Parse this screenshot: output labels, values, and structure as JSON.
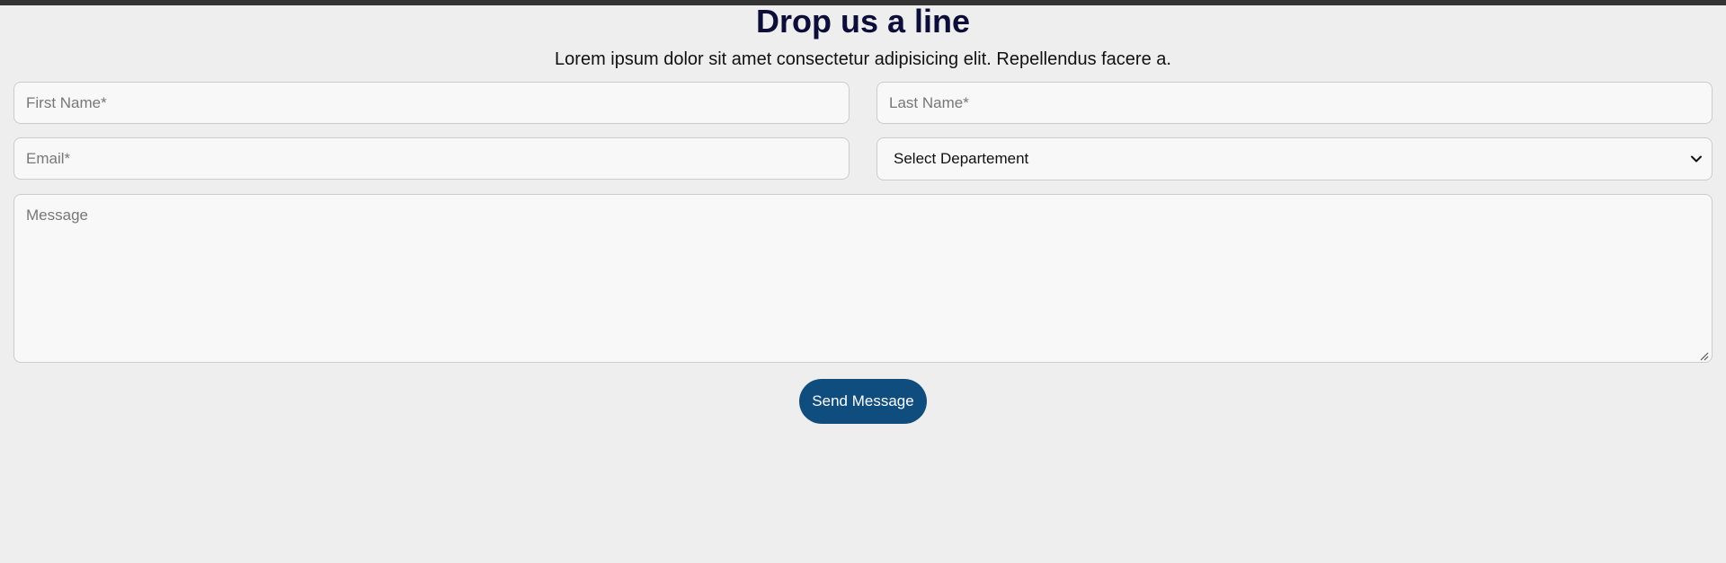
{
  "header": {
    "title": "Drop us a line",
    "subtitle": "Lorem ipsum dolor sit amet consectetur adipisicing elit. Repellendus facere a."
  },
  "form": {
    "first_name": {
      "placeholder": "First Name*",
      "value": ""
    },
    "last_name": {
      "placeholder": "Last Name*",
      "value": ""
    },
    "email": {
      "placeholder": "Email*",
      "value": ""
    },
    "department": {
      "selected": "Select Departement",
      "icon": "chevron-down-icon"
    },
    "message": {
      "placeholder": "Message",
      "value": ""
    },
    "submit_label": "Send Message"
  },
  "colors": {
    "background": "#eeeeee",
    "title": "#0d0d3a",
    "button": "#0f4d7e",
    "top_bar": "#333333"
  }
}
